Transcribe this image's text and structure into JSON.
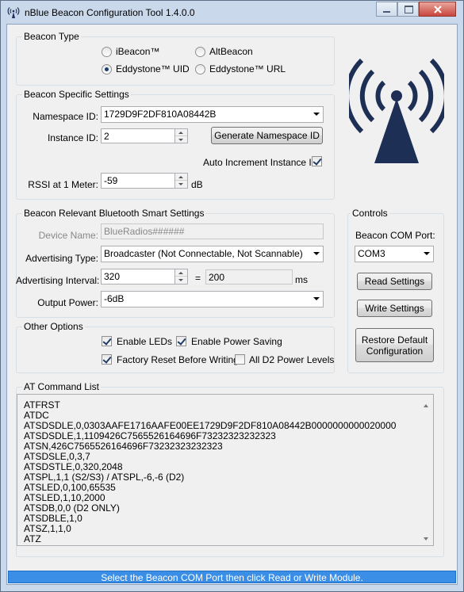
{
  "window": {
    "title": "nBlue Beacon Configuration Tool 1.4.0.0"
  },
  "beacon_type": {
    "label": "Beacon Type",
    "options": [
      {
        "label": "iBeacon™",
        "selected": false
      },
      {
        "label": "AltBeacon",
        "selected": false
      },
      {
        "label": "Eddystone™ UID",
        "selected": true
      },
      {
        "label": "Eddystone™ URL",
        "selected": false
      }
    ]
  },
  "specific": {
    "label": "Beacon Specific Settings",
    "namespace_label": "Namespace ID:",
    "namespace_value": "1729D9F2DF810A08442B",
    "instance_label": "Instance ID:",
    "instance_value": "2",
    "generate_button": "Generate Namespace ID",
    "auto_increment_label": "Auto Increment Instance ID",
    "auto_increment_checked": true,
    "rssi_label": "RSSI at 1 Meter:",
    "rssi_value": "-59",
    "rssi_unit": "dB"
  },
  "ble": {
    "label": "Beacon Relevant Bluetooth Smart Settings",
    "device_name_label": "Device Name:",
    "device_name_value": "BlueRadios######",
    "adv_type_label": "Advertising Type:",
    "adv_type_value": "Broadcaster (Not Connectable, Not Scannable)",
    "adv_interval_label": "Advertising Interval:",
    "adv_interval_value": "320",
    "equals": "=",
    "adv_interval_ms": "200",
    "ms_unit": "ms",
    "power_label": "Output Power:",
    "power_value": "-6dB"
  },
  "other": {
    "label": "Other Options",
    "enable_leds": "Enable LEDs",
    "enable_power_saving": "Enable Power Saving",
    "factory_reset": "Factory Reset Before Writing",
    "all_d2": "All D2 Power Levels",
    "checks": {
      "enable_leds": true,
      "enable_power_saving": true,
      "factory_reset": true,
      "all_d2": false
    }
  },
  "controls": {
    "label": "Controls",
    "com_label": "Beacon COM Port:",
    "com_value": "COM3",
    "read_button": "Read Settings",
    "write_button": "Write Settings",
    "restore_line1": "Restore Default",
    "restore_line2": "Configuration"
  },
  "at": {
    "label": "AT Command List",
    "lines": [
      "ATFRST",
      "ATDC",
      "ATSDSDLE,0,0303AAFE1716AAFE00EE1729D9F2DF810A08442B0000000000020000",
      "ATSDSDLE,1,1109426C7565526164696F73232323232323",
      "ATSN,426C7565526164696F73232323232323",
      "ATSDSLE,0,3,7",
      "ATSDSTLE,0,320,2048",
      "ATSPL,1,1 (S2/S3) / ATSPL,-6,-6 (D2)",
      "ATSLED,0,100,65535",
      "ATSLED,1,10,2000",
      "ATSDB,0,0 (D2 ONLY)",
      "ATSDBLE,1,0",
      "ATSZ,1,1,0",
      "ATZ"
    ]
  },
  "status": "Select the Beacon COM Port then click Read or Write Module.",
  "icons": {
    "app": "wifi-beacon-icon",
    "logo": "beacon-tower-icon"
  },
  "colors": {
    "status_bg": "#3b8ee6",
    "logo": "#1e2f55",
    "close": "#c9463d"
  }
}
